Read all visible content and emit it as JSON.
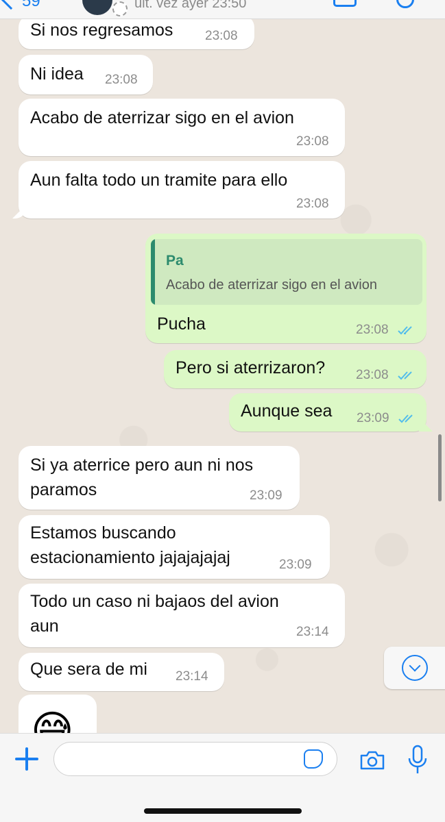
{
  "header": {
    "back_count": "59",
    "last_seen": "últ. vez ayer 23:50"
  },
  "messages": [
    {
      "dir": "in",
      "text": "Si nos regresamos",
      "time": "23:08"
    },
    {
      "dir": "in",
      "text": "Ni idea",
      "time": "23:08"
    },
    {
      "dir": "in",
      "text": "Acabo de aterrizar sigo en el avion",
      "time": "23:08"
    },
    {
      "dir": "in",
      "text": "Aun falta todo un tramite para ello",
      "time": "23:08"
    },
    {
      "dir": "out",
      "reply_to": {
        "name": "Pa",
        "text": "Acabo de aterrizar sigo en el avion"
      },
      "text": "Pucha",
      "time": "23:08",
      "status": "read"
    },
    {
      "dir": "out",
      "text": "Pero si aterrizaron?",
      "time": "23:08",
      "status": "read"
    },
    {
      "dir": "out",
      "text": "Aunque sea",
      "time": "23:09",
      "status": "read"
    },
    {
      "dir": "in",
      "line1": "Si ya aterrice pero aun ni nos",
      "line2": "paramos",
      "time": "23:09"
    },
    {
      "dir": "in",
      "line1": "Estamos buscando",
      "line2": "estacionamiento jajajajajaj",
      "time": "23:09"
    },
    {
      "dir": "in",
      "line1": "Todo un caso ni bajaos del avion",
      "line2": "aun",
      "time": "23:14"
    },
    {
      "dir": "in",
      "text": "Que sera de mi",
      "time": "23:14"
    },
    {
      "dir": "in",
      "emoji": "😅"
    }
  ],
  "colors": {
    "accent": "#1a7ff0",
    "incoming": "#ffffff",
    "outgoing": "#dcf8c6",
    "read_ticks": "#53bdeb",
    "quote_accent": "#2d8b6e"
  },
  "icons": {
    "attach": "plus-icon",
    "sticker": "sticker-icon",
    "camera": "camera-icon",
    "voice": "mic-icon",
    "scroll": "chevron-down-circle-icon"
  }
}
